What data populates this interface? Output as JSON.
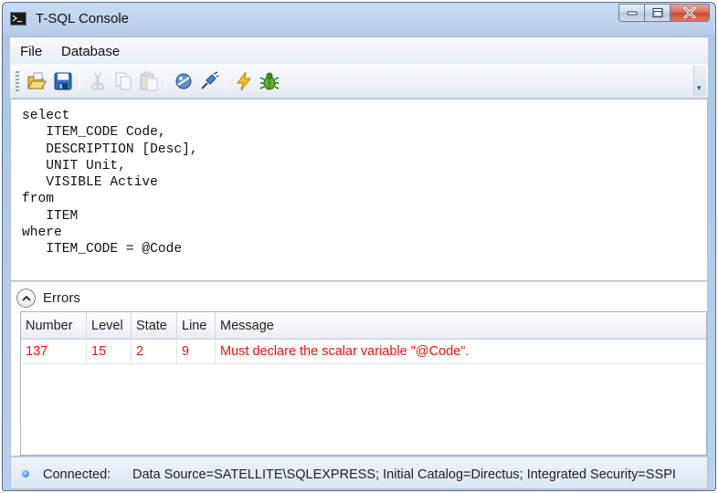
{
  "window": {
    "title": "T-SQL Console"
  },
  "menu": {
    "items": [
      {
        "label": "File"
      },
      {
        "label": "Database"
      }
    ]
  },
  "toolbar": {
    "buttons": [
      {
        "icon": "open-folder-icon",
        "enabled": true
      },
      {
        "icon": "save-icon",
        "enabled": true
      },
      {
        "icon": "cut-icon",
        "enabled": false
      },
      {
        "icon": "copy-icon",
        "enabled": false
      },
      {
        "icon": "paste-icon",
        "enabled": false
      },
      {
        "icon": "connect-icon",
        "enabled": true
      },
      {
        "icon": "disconnect-icon",
        "enabled": true
      },
      {
        "icon": "execute-icon",
        "enabled": true
      },
      {
        "icon": "debug-icon",
        "enabled": true
      }
    ]
  },
  "editor": {
    "lines": [
      "select",
      "   ITEM_CODE Code,",
      "   DESCRIPTION [Desc],",
      "   UNIT Unit,",
      "   VISIBLE Active",
      "from",
      "   ITEM",
      "where",
      "   ITEM_CODE = @Code"
    ]
  },
  "errors": {
    "title": "Errors",
    "columns": [
      "Number",
      "Level",
      "State",
      "Line",
      "Message"
    ],
    "rows": [
      {
        "number": "137",
        "level": "15",
        "state": "2",
        "line": "9",
        "message": "Must declare the scalar variable \"@Code\"."
      }
    ],
    "error_color": "#f01010"
  },
  "status": {
    "label": "Connected:",
    "connection": "Data Source=SATELLITE\\SQLEXPRESS; Initial Catalog=Directus; Integrated Security=SSPI"
  }
}
